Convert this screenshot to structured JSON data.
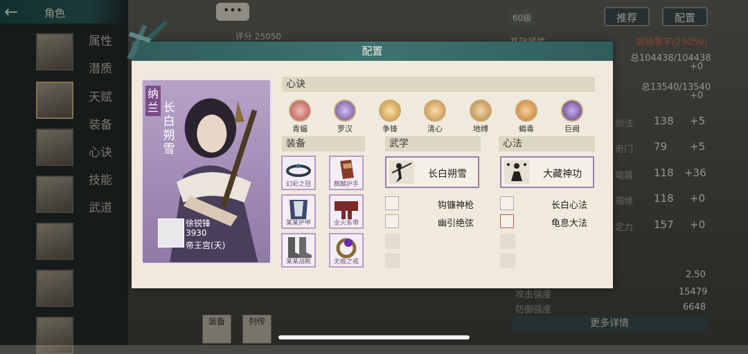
{
  "window": {
    "title": "角色",
    "back_icon": "back-arrow-icon"
  },
  "sidebar_menu": [
    "属性",
    "潜质",
    "天赋",
    "装备",
    "心诀",
    "技能",
    "武道"
  ],
  "top": {
    "level": "60级",
    "recommend_label": "推荐",
    "config_label": "配置",
    "chat_label": "•••",
    "score": "评分 25050"
  },
  "right_panel": {
    "base_attr_label": "基础属性",
    "title_value": "威镇寰宇(25050)",
    "hp": "总104438/104438",
    "hp_bonus": "+0",
    "mp": "总13540/13540",
    "mp_bonus": "+0",
    "stats": [
      {
        "label": "剑法",
        "value": "138",
        "bonus": "+5"
      },
      {
        "label": "奇门",
        "value": "79",
        "bonus": "+5"
      },
      {
        "label": "暗器",
        "value": "118",
        "bonus": "+36"
      },
      {
        "label": "福缘",
        "value": "118",
        "bonus": "+0"
      },
      {
        "label": "定力",
        "value": "157",
        "bonus": "+0"
      }
    ],
    "extra_value": "2.50",
    "attack_label": "攻击强度",
    "attack_value": "15479",
    "defense_label": "防御强度",
    "defense_value": "6648",
    "more_details": "更多详情"
  },
  "bottom_tabs": [
    "装备",
    "列传"
  ],
  "modal": {
    "title": "配置",
    "character": {
      "prefix": "纳兰",
      "name": "长白朔雪",
      "player_name": "徐锐锋",
      "player_power": "3930",
      "player_sect": "帝王宫(天)"
    },
    "xinjue_header": "心诀",
    "xinjue": [
      {
        "label": "青蝠",
        "color": "#b5484a"
      },
      {
        "label": "罗汉",
        "color": "#6a4a8e"
      },
      {
        "label": "争锋",
        "color": "#c9912f"
      },
      {
        "label": "清心",
        "color": "#c98a3a"
      },
      {
        "label": "地缚",
        "color": "#b8823a"
      },
      {
        "label": "蝎毒",
        "color": "#c77a2a"
      },
      {
        "label": "巨阙",
        "color": "#5a3a7e"
      }
    ],
    "equip_header": "装备",
    "equipment": [
      "幻彩之冠",
      "麒麟护手",
      "某某护甲",
      "业火系带",
      "某某战靴",
      "无极之戒"
    ],
    "wuxue_header": "武学",
    "wuxue_main": "长白朔雪",
    "wuxue_list": [
      "钩镰神枪",
      "幽引绝弦"
    ],
    "xinfa_header": "心法",
    "xinfa_main": "大藏神功",
    "xinfa_list": [
      "长白心法",
      "龟息大法"
    ]
  }
}
